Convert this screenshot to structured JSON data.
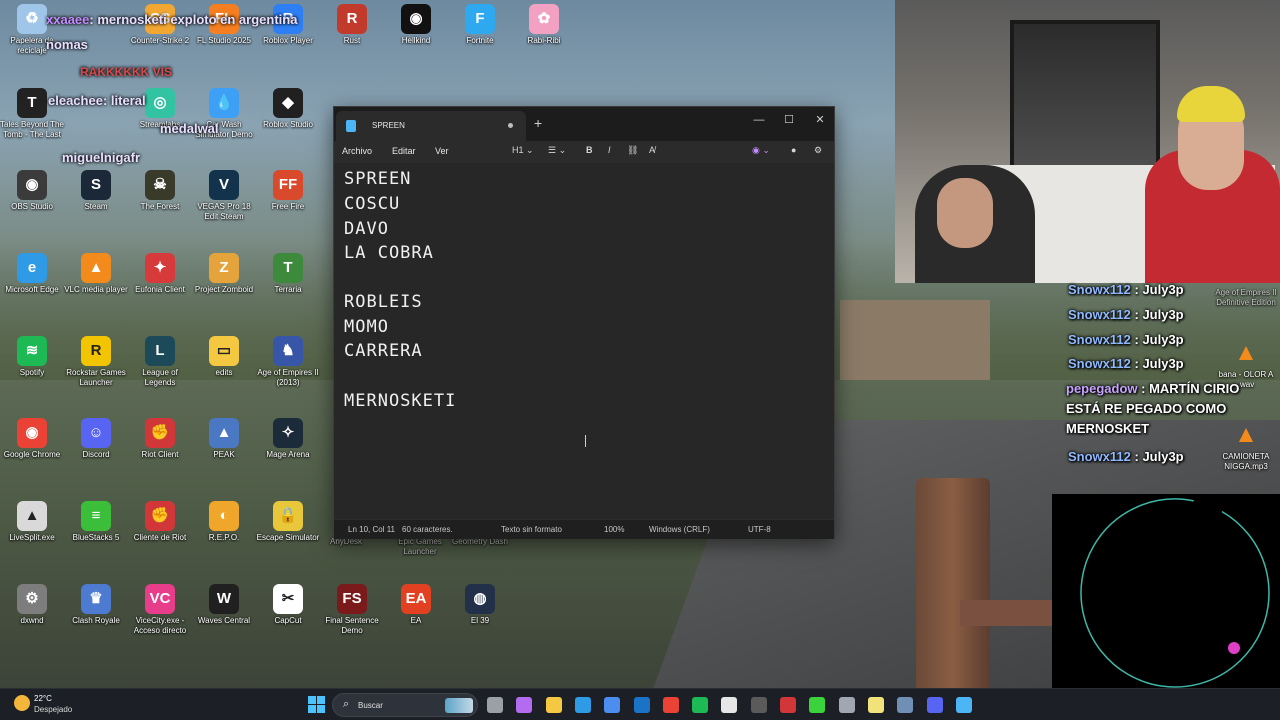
{
  "desktop": {
    "icons": [
      {
        "id": "recycle",
        "label": "Papelera de reciclaje",
        "color": "#9fc6e8",
        "glyph": "♻"
      },
      {
        "id": "cs2",
        "label": "Counter-Strike 2",
        "color": "#f2a733",
        "glyph": "CS"
      },
      {
        "id": "flstudio",
        "label": "FL Studio 2025",
        "color": "#f57e20",
        "glyph": "FL"
      },
      {
        "id": "roblox-player",
        "label": "Roblox Player",
        "color": "#2e7ff3",
        "glyph": "R"
      },
      {
        "id": "rust",
        "label": "Rust",
        "color": "#c23a2b",
        "glyph": "R"
      },
      {
        "id": "hellkind",
        "label": "Hellkind",
        "color": "#111111",
        "glyph": "◉"
      },
      {
        "id": "fortnite",
        "label": "Fortnite",
        "color": "#2ea9f0",
        "glyph": "F"
      },
      {
        "id": "rabiribi",
        "label": "Rabi-Ribi",
        "color": "#f3a1c3",
        "glyph": "✿"
      },
      {
        "id": "tbtt",
        "label": "Tales Beyond The Tomb - The Last",
        "color": "#222222",
        "glyph": "T"
      },
      {
        "id": "streamlabs",
        "label": "Streamlabs",
        "color": "#31c3a2",
        "glyph": "◎"
      },
      {
        "id": "carwash",
        "label": "Car Wash Simulator Demo",
        "color": "#3da0f5",
        "glyph": "💧"
      },
      {
        "id": "roblox-studio",
        "label": "Roblox Studio",
        "color": "#202020",
        "glyph": "◆"
      },
      {
        "id": "obs",
        "label": "OBS Studio",
        "color": "#3b3b3b",
        "glyph": "◉"
      },
      {
        "id": "steam",
        "label": "Steam",
        "color": "#1b2838",
        "glyph": "S"
      },
      {
        "id": "theforest",
        "label": "The Forest",
        "color": "#3a3a2a",
        "glyph": "☠"
      },
      {
        "id": "vegas",
        "label": "VEGAS Pro 18 Edit Steam",
        "color": "#13334d",
        "glyph": "V"
      },
      {
        "id": "freefire",
        "label": "Free Fire",
        "color": "#d84a2b",
        "glyph": "FF"
      },
      {
        "id": "edge",
        "label": "Microsoft Edge",
        "color": "#2f9be6",
        "glyph": "e"
      },
      {
        "id": "vlc",
        "label": "VLC media player",
        "color": "#f28a1c",
        "glyph": "▲"
      },
      {
        "id": "eufonia",
        "label": "Eufonia Client",
        "color": "#d63a3a",
        "glyph": "✦"
      },
      {
        "id": "zomboid",
        "label": "Project Zomboid",
        "color": "#e4a43b",
        "glyph": "Z"
      },
      {
        "id": "terraria",
        "label": "Terraria",
        "color": "#3d8a3c",
        "glyph": "T"
      },
      {
        "id": "spotify",
        "label": "Spotify",
        "color": "#1db954",
        "glyph": "≋"
      },
      {
        "id": "rockstar",
        "label": "Rockstar Games Launcher",
        "color": "#f3c500",
        "glyph": "R"
      },
      {
        "id": "lol",
        "label": "League of Legends",
        "color": "#1d4a58",
        "glyph": "L"
      },
      {
        "id": "edits",
        "label": "edits",
        "color": "#f5c842",
        "glyph": "▭"
      },
      {
        "id": "aoe2",
        "label": "Age of Empires II (2013)",
        "color": "#3856a8",
        "glyph": "♞"
      },
      {
        "id": "chrome",
        "label": "Google Chrome",
        "color": "#ea4335",
        "glyph": "◉"
      },
      {
        "id": "discord",
        "label": "Discord",
        "color": "#5865f2",
        "glyph": "☺"
      },
      {
        "id": "riotclient",
        "label": "Riot Client",
        "color": "#d13639",
        "glyph": "✊"
      },
      {
        "id": "peak",
        "label": "PEAK",
        "color": "#4b78c2",
        "glyph": "▲"
      },
      {
        "id": "magearena",
        "label": "Mage Arena",
        "color": "#1c2b3a",
        "glyph": "✧"
      },
      {
        "id": "livesplit",
        "label": "LiveSplit.exe",
        "color": "#d9d9d9",
        "glyph": "▲"
      },
      {
        "id": "bluestacks",
        "label": "BlueStacks 5",
        "color": "#3bbf3b",
        "glyph": "≡"
      },
      {
        "id": "clienteriot",
        "label": "Cliente de Riot",
        "color": "#d13639",
        "glyph": "✊"
      },
      {
        "id": "repo",
        "label": "R.E.P.O.",
        "color": "#f0a62b",
        "glyph": "◐"
      },
      {
        "id": "escape",
        "label": "Escape Simulator",
        "color": "#e9c73b",
        "glyph": "🔒"
      },
      {
        "id": "dxwnd",
        "label": "dxwnd",
        "color": "#7d7d7d",
        "glyph": "⚙"
      },
      {
        "id": "clashroyale",
        "label": "Clash Royale",
        "color": "#4c7bd1",
        "glyph": "♛"
      },
      {
        "id": "vicecity",
        "label": "ViceCity.exe - Acceso directo",
        "color": "#e83d8a",
        "glyph": "VC"
      },
      {
        "id": "waves",
        "label": "Waves Central",
        "color": "#202020",
        "glyph": "W"
      },
      {
        "id": "capcut",
        "label": "CapCut",
        "color": "#ffffff",
        "glyph": "✂"
      },
      {
        "id": "finalsentence",
        "label": "Final Sentence Demo",
        "color": "#7a1a1a",
        "glyph": "FS"
      },
      {
        "id": "ea",
        "label": "EA",
        "color": "#e14021",
        "glyph": "EA"
      },
      {
        "id": "el39",
        "label": "El 39",
        "color": "#23304a",
        "glyph": "◍"
      }
    ],
    "behind_window_labels": [
      "AnyDesk",
      "Epic Games Launcher",
      "Geometry Dash"
    ]
  },
  "stream_overlay": {
    "top_messages": [
      {
        "user": "xxaaee",
        "text": "mernosketi exploto en argentina"
      },
      {
        "user": "nomas",
        "text": ""
      },
      {
        "user": "",
        "text": "RAKKKKKK VIS"
      },
      {
        "user": "eleachee",
        "text": "literal"
      },
      {
        "user": "medalwal",
        "text": ""
      },
      {
        "user": "miguelnigafr",
        "text": ""
      }
    ],
    "chat": [
      {
        "user": "Snowx112",
        "text": "July3p"
      },
      {
        "user": "Snowx112",
        "text": "July3p"
      },
      {
        "user": "Snowx112",
        "text": "July3p"
      },
      {
        "user": "Snowx112",
        "text": "July3p"
      },
      {
        "user": "pepegadow",
        "text": "MARTÍN CIRIO ESTÁ RE PEGADO COMO MERNOSKET"
      },
      {
        "user": "Snowx112",
        "text": "July3p"
      }
    ],
    "side_files": [
      {
        "label": "Age of Empires II Definitive Edition"
      },
      {
        "label": "bana - OLOR A .wav"
      },
      {
        "label": "CAMIONETA NIGGA.mp3"
      }
    ]
  },
  "notepad": {
    "tab_title": "SPREEN",
    "menu": [
      "Archivo",
      "Editar",
      "Ver"
    ],
    "toolbar": {
      "heading": "H1",
      "bold": "B",
      "italic": "I"
    },
    "lines": [
      "SPREEN",
      "COSCU",
      "DAVO",
      "LA COBRA",
      "",
      "ROBLEIS",
      "MOMO",
      "CARRERA",
      "",
      "MERNOSKETI"
    ],
    "status": {
      "position": "Ln 10, Col 11",
      "chars": "60 caracteres.",
      "format": "Texto sin formato",
      "zoom": "100%",
      "line_ending": "Windows (CRLF)",
      "encoding": "UTF-8"
    }
  },
  "taskbar": {
    "weather_temp": "22°C",
    "weather_desc": "Despejado",
    "search_placeholder": "Buscar",
    "apps": [
      {
        "name": "task-view",
        "color": "#9aa0a6"
      },
      {
        "name": "copilot",
        "color": "#b36cf0"
      },
      {
        "name": "file-explorer",
        "color": "#f5c842"
      },
      {
        "name": "edge",
        "color": "#2f9be6"
      },
      {
        "name": "store",
        "color": "#4b8ef0"
      },
      {
        "name": "outlook",
        "color": "#1a73c7"
      },
      {
        "name": "chrome",
        "color": "#ea4335"
      },
      {
        "name": "spotify",
        "color": "#1db954"
      },
      {
        "name": "capcut",
        "color": "#e6e6e6"
      },
      {
        "name": "obs",
        "color": "#5a5a5a"
      },
      {
        "name": "app-red",
        "color": "#d13639"
      },
      {
        "name": "razer",
        "color": "#3bd33b"
      },
      {
        "name": "settings",
        "color": "#a0a7b0"
      },
      {
        "name": "notes",
        "color": "#f1e27a"
      },
      {
        "name": "steam",
        "color": "#6f8fb5"
      },
      {
        "name": "discord",
        "color": "#5865f2"
      },
      {
        "name": "notepad",
        "color": "#4cb5f5"
      }
    ]
  },
  "colors": {
    "notepad_bg": "#272727",
    "chat_user": "#8fb8ff",
    "viz_ring": "#3fb7a7",
    "viz_dot": "#e040c8"
  }
}
